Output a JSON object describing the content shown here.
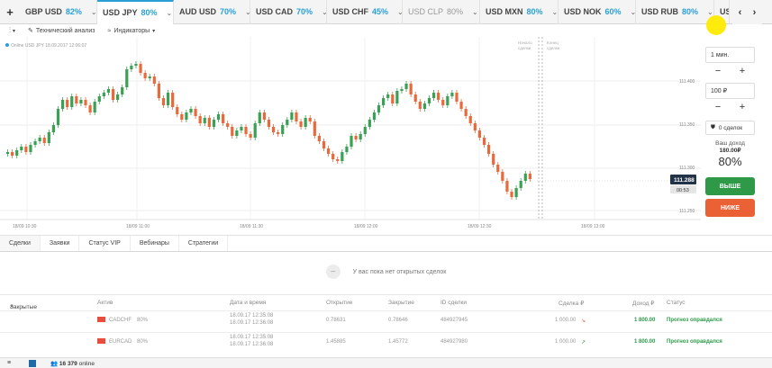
{
  "tabs": [
    {
      "name": "GBP USD",
      "pct": "82%",
      "active": false,
      "muted": false
    },
    {
      "name": "USD JPY",
      "pct": "80%",
      "active": true,
      "muted": false
    },
    {
      "name": "AUD USD",
      "pct": "70%",
      "active": false,
      "muted": false
    },
    {
      "name": "USD CAD",
      "pct": "70%",
      "active": false,
      "muted": false
    },
    {
      "name": "USD CHF",
      "pct": "45%",
      "active": false,
      "muted": false
    },
    {
      "name": "USD CLP",
      "pct": "80%",
      "active": false,
      "muted": true
    },
    {
      "name": "USD MXN",
      "pct": "80%",
      "active": false,
      "muted": false
    },
    {
      "name": "USD NOK",
      "pct": "60%",
      "active": false,
      "muted": false
    },
    {
      "name": "USD RUB",
      "pct": "80%",
      "active": false,
      "muted": false
    },
    {
      "name": "US",
      "pct": "",
      "active": false,
      "muted": false
    }
  ],
  "toolbar": {
    "analysis": "Технический анализ",
    "indicators": "Индикаторы"
  },
  "chart_info": "Online USD JPY 18.09.2017 12:06:07",
  "markers": {
    "end_deals": "Начало\nсделки",
    "close_deals": "Конец\nсделки"
  },
  "price_labels": [
    "111.400",
    "111.350",
    "111.300",
    "111.250"
  ],
  "time_labels": [
    "18/09 10:30",
    "18/09 11:00",
    "18/09 11:30",
    "18/09 12:00",
    "18/09 12:30",
    "18/09 13:00"
  ],
  "current_price": "111.288",
  "countdown": "00:53",
  "right_panel": {
    "time_value": "1 мин.",
    "amount_value": "100 ₽",
    "deals": "0 сделок",
    "income_label": "Ваш доход",
    "income_amount": "180.00₽",
    "income_pct": "80%",
    "up_label": "ВЫШЕ",
    "down_label": "НИЖЕ",
    "colors": {
      "up": "#2e9a48",
      "down": "#ea6136"
    }
  },
  "bottom_tabs": [
    "Сделки",
    "Заявки",
    "Статус VIP",
    "Вебинары",
    "Стратегии"
  ],
  "empty_text": "У вас пока нет открытых сделок",
  "closed_headers": {
    "closed": "Закрытые",
    "asset": "Актив",
    "datetime": "Дата и время",
    "open": "Открытие",
    "close": "Закрытие",
    "id": "ID сделки",
    "deal": "Сделка ₽",
    "income": "Доход ₽",
    "status": "Статус"
  },
  "closed_rows": [
    {
      "asset": "CADCHF",
      "pct": "80%",
      "date1": "18.09.17 12:35:08",
      "date2": "18.09.17 12:36:08",
      "open": "0.78631",
      "close": "0.78646",
      "id": "484927945",
      "amount": "1 000.00",
      "arrow": "↘",
      "income": "1 800.00",
      "status": "Прогноз оправдался"
    },
    {
      "asset": "EURCAD",
      "pct": "80%",
      "date1": "18.09.17 12:35:08",
      "date2": "18.09.17 12:36:08",
      "open": "1.45885",
      "close": "1.45772",
      "id": "484927980",
      "amount": "1 000.00",
      "arrow": "↗",
      "income": "1 800.00",
      "status": "Прогноз оправдался"
    }
  ],
  "online_count": "16 379",
  "online_label": "online"
}
